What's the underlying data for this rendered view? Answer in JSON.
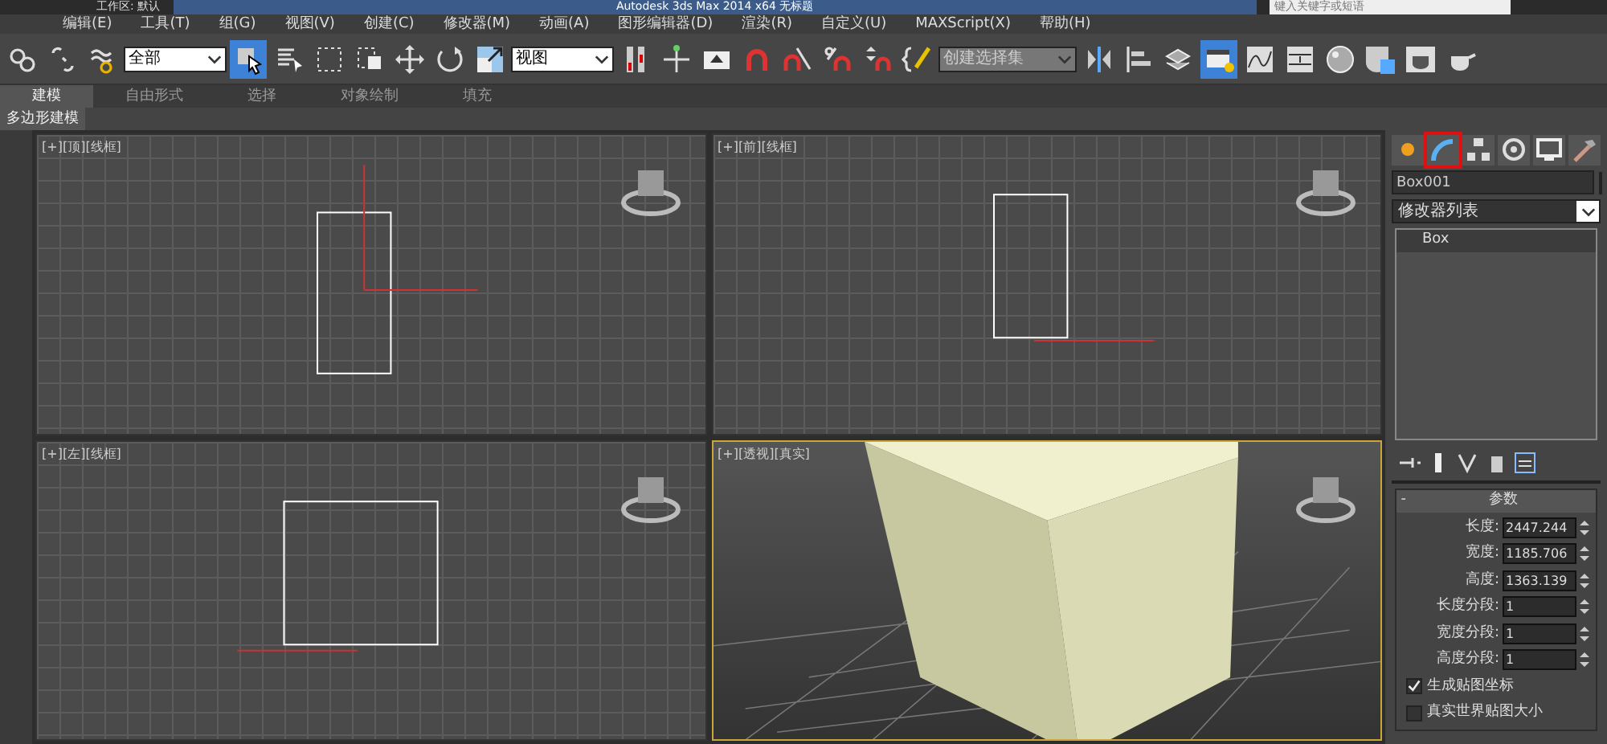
{
  "title_bar": {
    "workspace": "工作区: 默认",
    "title": "Autodesk 3ds Max  2014 x64    无标题",
    "search": {
      "placeholder": "键入关键字或短语"
    }
  },
  "menu": [
    "编辑(E)",
    "工具(T)",
    "组(G)",
    "视图(V)",
    "创建(C)",
    "修改器(M)",
    "动画(A)",
    "图形编辑器(D)",
    "渲染(R)",
    "自定义(U)",
    "MAXScript(X)",
    "帮助(H)"
  ],
  "toolbar": [
    {
      "kind": "link",
      "selected": false
    },
    {
      "kind": "unlink",
      "selected": false
    },
    {
      "kind": "bind",
      "selected": false
    },
    {
      "kind": "dropdown",
      "value": "全部"
    },
    {
      "kind": "select",
      "selected": true
    },
    {
      "kind": "select-name",
      "selected": false
    },
    {
      "kind": "region",
      "selected": false
    },
    {
      "kind": "crossing",
      "selected": false
    },
    {
      "kind": "move",
      "selected": false
    },
    {
      "kind": "rotate",
      "selected": false
    },
    {
      "kind": "scale",
      "selected": false
    },
    {
      "kind": "dropdown",
      "value": "视图"
    },
    {
      "kind": "pivot",
      "selected": false
    },
    {
      "kind": "manipulate",
      "selected": false
    },
    {
      "kind": "keyboard",
      "selected": false
    },
    {
      "kind": "snap",
      "selected": false
    },
    {
      "kind": "angle-snap",
      "selected": false
    },
    {
      "kind": "percent-snap",
      "selected": false
    },
    {
      "kind": "spinner-snap",
      "selected": false
    },
    {
      "kind": "edit-named",
      "selected": false
    },
    {
      "kind": "dropdown",
      "value": "创建选择集"
    },
    {
      "kind": "mirror",
      "selected": false
    },
    {
      "kind": "align",
      "selected": false
    },
    {
      "kind": "layers",
      "selected": false
    },
    {
      "kind": "explorer",
      "selected": true
    },
    {
      "kind": "curve",
      "selected": false
    },
    {
      "kind": "schematic",
      "selected": false
    },
    {
      "kind": "material",
      "selected": false
    },
    {
      "kind": "render-setup",
      "selected": false
    },
    {
      "kind": "render-frame",
      "selected": false
    },
    {
      "kind": "render",
      "selected": false
    }
  ],
  "ribbon_tabs": [
    {
      "label": "建模",
      "selected": true
    },
    {
      "label": "自由形式",
      "selected": false
    },
    {
      "label": "选择",
      "selected": false
    },
    {
      "label": "对象绘制",
      "selected": false
    },
    {
      "label": "填充",
      "selected": false
    }
  ],
  "ribbon_panel": "多边形建模",
  "viewports": [
    {
      "label": "[+][顶][线框]",
      "kind": "top",
      "selected": false
    },
    {
      "label": "[+][前][线框]",
      "kind": "front",
      "selected": false
    },
    {
      "label": "[+][左][线框]",
      "kind": "left",
      "selected": false
    },
    {
      "label": "[+][透视][真实]",
      "kind": "perspective",
      "selected": true
    }
  ],
  "command_panel": {
    "tabs": [
      {
        "kind": "create",
        "selected": false
      },
      {
        "kind": "modify",
        "selected": true
      },
      {
        "kind": "hierarchy",
        "selected": false
      },
      {
        "kind": "motion",
        "selected": false
      },
      {
        "kind": "display",
        "selected": false
      },
      {
        "kind": "utilities",
        "selected": false
      }
    ],
    "object_name": "Box001",
    "modifier_list": "修改器列表",
    "stack": [
      "Box"
    ],
    "rollout": {
      "toggle": "-",
      "title": "参数"
    },
    "params": [
      {
        "label": "长度:",
        "value": "2447.244"
      },
      {
        "label": "宽度:",
        "value": "1185.706"
      },
      {
        "label": "高度:",
        "value": "1363.139"
      },
      {
        "label": "长度分段:",
        "value": "1"
      },
      {
        "label": "宽度分段:",
        "value": "1"
      },
      {
        "label": "高度分段:",
        "value": "1"
      }
    ],
    "options": [
      {
        "label": "生成贴图坐标",
        "checked": true
      },
      {
        "label": "真实世界贴图大小",
        "checked": false
      }
    ]
  }
}
